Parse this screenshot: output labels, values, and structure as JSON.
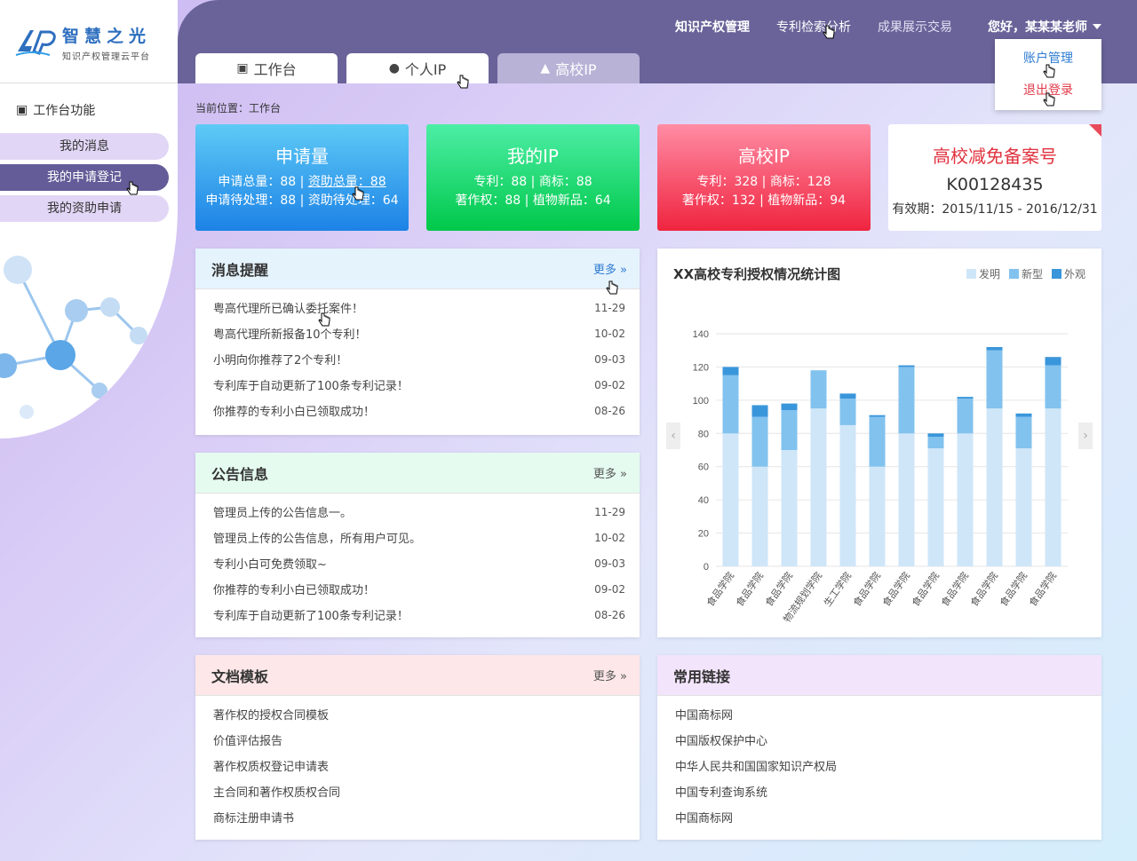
{
  "brand": {
    "title": "智慧之光",
    "subtitle": "知识产权管理云平台"
  },
  "topnav": {
    "items": [
      "知识产权管理",
      "专利检索分析",
      "成果展示交易"
    ],
    "user": "您好，某某某老师"
  },
  "dropdown": {
    "account": "账户管理",
    "logout": "退出登录"
  },
  "tabs": [
    "工作台",
    "个人IP",
    "高校IP"
  ],
  "sidebar": {
    "title": "工作台功能",
    "items": [
      "我的消息",
      "我的申请登记",
      "我的资助申请"
    ]
  },
  "breadcrumb": "当前位置：工作台",
  "stats": {
    "apply": {
      "title": "申请量",
      "line1a": "申请总量：88",
      "line1b": "资助总量：88",
      "line2a": "申请待处理：88",
      "line2b": "资助待处理：64"
    },
    "myip": {
      "title": "我的IP",
      "line1a": "专利：88",
      "line1b": "商标：88",
      "line2a": "著作权：88",
      "line2b": "植物新品：64"
    },
    "schoolip": {
      "title": "高校IP",
      "line1a": "专利：328",
      "line1b": "商标：128",
      "line2a": "著作权：132",
      "line2b": "植物新品：94"
    },
    "record": {
      "title": "高校减免备案号",
      "code": "K00128435",
      "valid": "有效期：2015/11/15 - 2016/12/31"
    }
  },
  "messages": {
    "title": "消息提醒",
    "more": "更多",
    "items": [
      {
        "text": "粤高代理所已确认委托案件！",
        "date": "11-29"
      },
      {
        "text": "粤高代理所新报备10个专利！",
        "date": "10-02"
      },
      {
        "text": "小明向你推荐了2个专利！",
        "date": "09-03"
      },
      {
        "text": "专利库于自动更新了100条专利记录！",
        "date": "09-02"
      },
      {
        "text": "你推荐的专利小白已领取成功！",
        "date": "08-26"
      }
    ]
  },
  "notices": {
    "title": "公告信息",
    "more": "更多",
    "items": [
      {
        "text": "管理员上传的公告信息一。",
        "date": "11-29"
      },
      {
        "text": "管理员上传的公告信息，所有用户可见。",
        "date": "10-02"
      },
      {
        "text": "专利小白可免费领取~",
        "date": "09-03"
      },
      {
        "text": "你推荐的专利小白已领取成功！",
        "date": "09-02"
      },
      {
        "text": "专利库于自动更新了100条专利记录！",
        "date": "08-26"
      }
    ]
  },
  "docs": {
    "title": "文档模板",
    "more": "更多",
    "items": [
      "著作权的授权合同模板",
      "价值评估报告",
      "著作权质权登记申请表",
      "主合同和著作权质权合同",
      "商标注册申请书"
    ]
  },
  "links": {
    "title": "常用链接",
    "items": [
      "中国商标网",
      "中国版权保护中心",
      "中华人民共和国国家知识产权局",
      "中国专利查询系统",
      "中国商标网"
    ]
  },
  "colors": {
    "topbar": "#6a6399",
    "invention": "#cfe6f8",
    "utility": "#82c2ee",
    "design": "#3a96db"
  },
  "chart_data": {
    "type": "bar",
    "title": "XX高校专利授权情况统计图",
    "categories": [
      "食品学院",
      "食品学院",
      "食品学院",
      "物流规划学院",
      "生工学院",
      "食品学院",
      "食品学院",
      "食品学院",
      "食品学院",
      "食品学院",
      "食品学院",
      "食品学院"
    ],
    "series": [
      {
        "name": "发明",
        "values": [
          80,
          60,
          70,
          95,
          85,
          60,
          80,
          71,
          80,
          95,
          71,
          95
        ]
      },
      {
        "name": "新型",
        "values": [
          35,
          30,
          24,
          23,
          16,
          30,
          40,
          7,
          21,
          35,
          19,
          26
        ]
      },
      {
        "name": "外观",
        "values": [
          5,
          7,
          4,
          0,
          3,
          1,
          1,
          2,
          1,
          2,
          2,
          5
        ]
      }
    ],
    "stacked": true,
    "ylim": [
      0,
      140
    ],
    "yticks": [
      0,
      20,
      40,
      60,
      80,
      100,
      120,
      140
    ],
    "legend": "top-right",
    "grid": true
  }
}
